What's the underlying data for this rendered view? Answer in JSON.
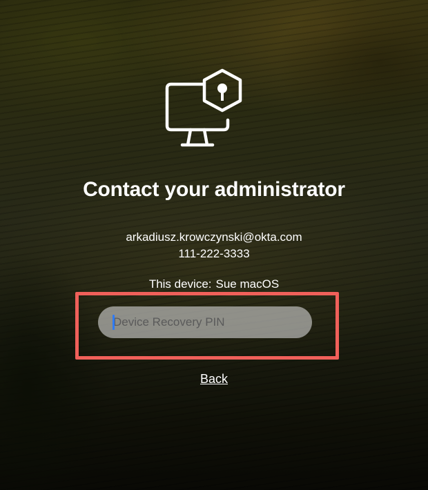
{
  "dialog": {
    "icon": "device-lock-icon",
    "title": "Contact your administrator",
    "admin_email": "arkadiusz.krowczynski@okta.com",
    "admin_phone": "111-222-3333",
    "device_label": "This device:",
    "device_name": "Sue macOS",
    "pin_input": {
      "placeholder": "Device Recovery PIN",
      "value": ""
    },
    "back_label": "Back"
  },
  "colors": {
    "text": "#ffffff",
    "highlight_border": "#f0605a",
    "input_background": "#d2d2d2",
    "caret": "#2f7bf5"
  }
}
